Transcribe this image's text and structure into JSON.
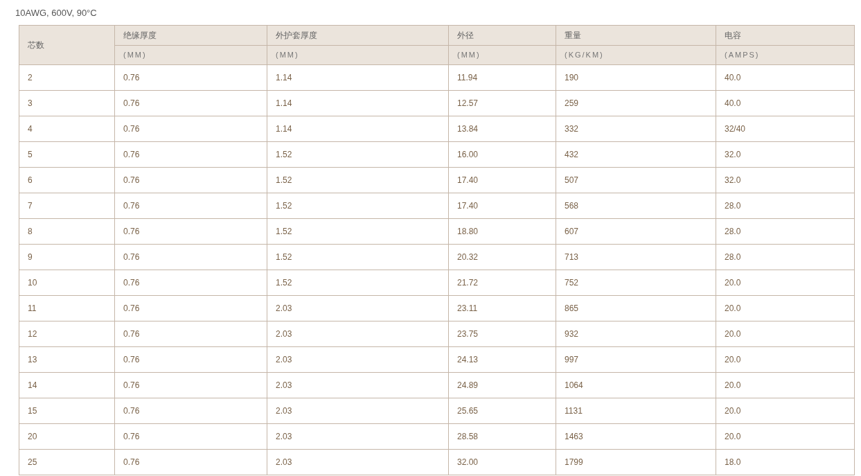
{
  "title": "10AWG, 600V, 90°C",
  "table": {
    "columns": [
      {
        "name": "芯数"
      },
      {
        "name": "绝缘厚度",
        "unit": "(MM)"
      },
      {
        "name": "外护套厚度",
        "unit": "(MM)"
      },
      {
        "name": "外径",
        "unit": "(MM)"
      },
      {
        "name": "重量",
        "unit": "(KG/KM)"
      },
      {
        "name": "电容",
        "unit": "(AMPS)"
      }
    ],
    "rows": [
      [
        "2",
        "0.76",
        "1.14",
        "11.94",
        "190",
        "40.0"
      ],
      [
        "3",
        "0.76",
        "1.14",
        "12.57",
        "259",
        "40.0"
      ],
      [
        "4",
        "0.76",
        "1.14",
        "13.84",
        "332",
        "32/40"
      ],
      [
        "5",
        "0.76",
        "1.52",
        "16.00",
        "432",
        "32.0"
      ],
      [
        "6",
        "0.76",
        "1.52",
        "17.40",
        "507",
        "32.0"
      ],
      [
        "7",
        "0.76",
        "1.52",
        "17.40",
        "568",
        "28.0"
      ],
      [
        "8",
        "0.76",
        "1.52",
        "18.80",
        "607",
        "28.0"
      ],
      [
        "9",
        "0.76",
        "1.52",
        "20.32",
        "713",
        "28.0"
      ],
      [
        "10",
        "0.76",
        "1.52",
        "21.72",
        "752",
        "20.0"
      ],
      [
        "11",
        "0.76",
        "2.03",
        "23.11",
        "865",
        "20.0"
      ],
      [
        "12",
        "0.76",
        "2.03",
        "23.75",
        "932",
        "20.0"
      ],
      [
        "13",
        "0.76",
        "2.03",
        "24.13",
        "997",
        "20.0"
      ],
      [
        "14",
        "0.76",
        "2.03",
        "24.89",
        "1064",
        "20.0"
      ],
      [
        "15",
        "0.76",
        "2.03",
        "25.65",
        "1131",
        "20.0"
      ],
      [
        "20",
        "0.76",
        "2.03",
        "28.58",
        "1463",
        "20.0"
      ],
      [
        "25",
        "0.76",
        "2.03",
        "32.00",
        "1799",
        "18.0"
      ]
    ]
  }
}
